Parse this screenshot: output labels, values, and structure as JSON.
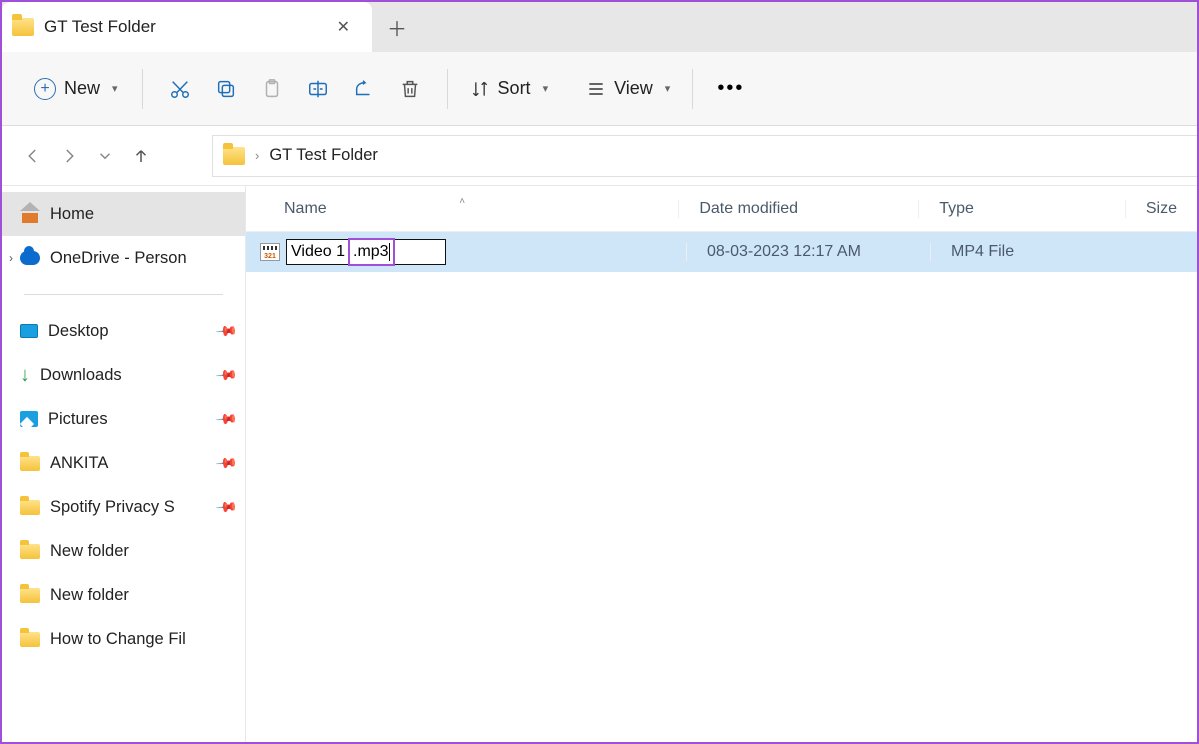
{
  "tab": {
    "title": "GT Test Folder"
  },
  "toolbar": {
    "new_label": "New",
    "sort_label": "Sort",
    "view_label": "View"
  },
  "address": {
    "path": "GT Test Folder"
  },
  "sidebar": {
    "home": "Home",
    "onedrive": "OneDrive - Person",
    "quick": [
      {
        "label": "Desktop",
        "pinned": true,
        "icon": "desktop"
      },
      {
        "label": "Downloads",
        "pinned": true,
        "icon": "down"
      },
      {
        "label": "Pictures",
        "pinned": true,
        "icon": "pic"
      },
      {
        "label": "ANKITA",
        "pinned": true,
        "icon": "folder"
      },
      {
        "label": "Spotify Privacy S",
        "pinned": true,
        "icon": "folder"
      },
      {
        "label": "New folder",
        "pinned": false,
        "icon": "folder"
      },
      {
        "label": "New folder",
        "pinned": false,
        "icon": "folder"
      },
      {
        "label": "How to Change Fil",
        "pinned": false,
        "icon": "folder"
      }
    ]
  },
  "columns": {
    "name": "Name",
    "date": "Date modified",
    "type": "Type",
    "size": "Size"
  },
  "file": {
    "name_base": "Video 1",
    "name_ext": ".mp3",
    "date": "08-03-2023 12:17 AM",
    "type": "MP4 File",
    "size": ""
  }
}
